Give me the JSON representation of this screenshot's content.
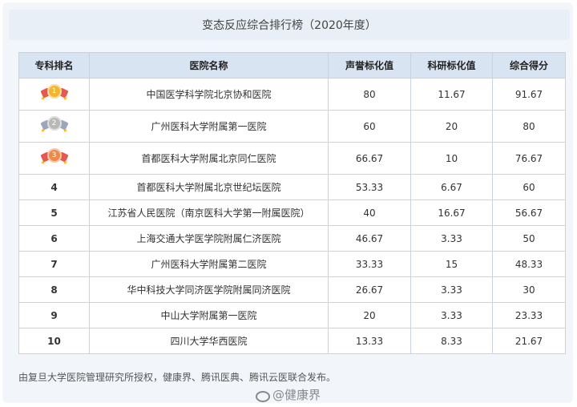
{
  "title": "变态反应综合排行榜（2020年度）",
  "table": {
    "headers": [
      "专科排名",
      "医院名称",
      "声誉标化值",
      "科研标化值",
      "综合得分"
    ],
    "rows": [
      {
        "rank": "1",
        "hospital": "中国医学科学院北京协和医院",
        "reputation": "80",
        "research": "11.67",
        "score": "91.67",
        "medal": "gold"
      },
      {
        "rank": "2",
        "hospital": "广州医科大学附属第一医院",
        "reputation": "60",
        "research": "20",
        "score": "80",
        "medal": "silver"
      },
      {
        "rank": "3",
        "hospital": "首都医科大学附属北京同仁医院",
        "reputation": "66.67",
        "research": "10",
        "score": "76.67",
        "medal": "bronze"
      },
      {
        "rank": "4",
        "hospital": "首都医科大学附属北京世纪坛医院",
        "reputation": "53.33",
        "research": "6.67",
        "score": "60",
        "medal": ""
      },
      {
        "rank": "5",
        "hospital": "江苏省人民医院（南京医科大学第一附属医院）",
        "reputation": "40",
        "research": "16.67",
        "score": "56.67",
        "medal": ""
      },
      {
        "rank": "6",
        "hospital": "上海交通大学医学院附属仁济医院",
        "reputation": "46.67",
        "research": "3.33",
        "score": "50",
        "medal": ""
      },
      {
        "rank": "7",
        "hospital": "广州医科大学附属第二医院",
        "reputation": "33.33",
        "research": "15",
        "score": "48.33",
        "medal": ""
      },
      {
        "rank": "8",
        "hospital": "华中科技大学同济医学院附属同济医院",
        "reputation": "26.67",
        "research": "3.33",
        "score": "30",
        "medal": ""
      },
      {
        "rank": "9",
        "hospital": "中山大学附属第一医院",
        "reputation": "20",
        "research": "3.33",
        "score": "23.33",
        "medal": ""
      },
      {
        "rank": "10",
        "hospital": "四川大学华西医院",
        "reputation": "13.33",
        "research": "8.33",
        "score": "21.67",
        "medal": ""
      }
    ]
  },
  "footer": "由复旦大学医院管理研究所授权，健康界、腾讯医典、腾讯云医联合发布。",
  "watermark": "@健康界",
  "colors": {
    "gold": "#f2b531",
    "silver": "#b8b8b8",
    "bronze": "#ec8a4a",
    "ribbon": "#e6584d",
    "header_bg": "#d9e4f2",
    "border": "#c9d3e0"
  }
}
